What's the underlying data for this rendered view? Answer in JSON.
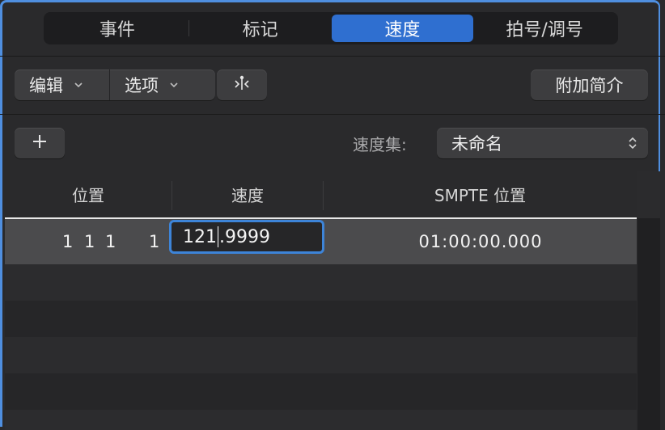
{
  "tabs": [
    {
      "label": "事件",
      "active": false
    },
    {
      "label": "标记",
      "active": false
    },
    {
      "label": "速度",
      "active": true
    },
    {
      "label": "拍号/调号",
      "active": false
    }
  ],
  "toolbar": {
    "edit_menu_label": "编辑",
    "options_menu_label": "选项",
    "snap_icon": "catch-playhead-icon",
    "add_info_label": "附加简介"
  },
  "tempo_set": {
    "add_button_icon": "plus-icon",
    "label": "速度集:",
    "selected_value": "未命名"
  },
  "table": {
    "columns": [
      "位置",
      "速度",
      "SMPTE 位置"
    ],
    "rows": [
      {
        "position": {
          "bar": "1",
          "beat": "1",
          "division": "1",
          "tick": "1"
        },
        "tempo_before_caret": "121",
        "tempo_after_caret": ".9999",
        "smpte": "01:00:00.000",
        "selected": true
      }
    ]
  },
  "colors": {
    "accent": "#2f6fd0",
    "focus_ring": "#3d84d8",
    "window_border": "#4f8fe0",
    "background": "#2a2a2c"
  }
}
